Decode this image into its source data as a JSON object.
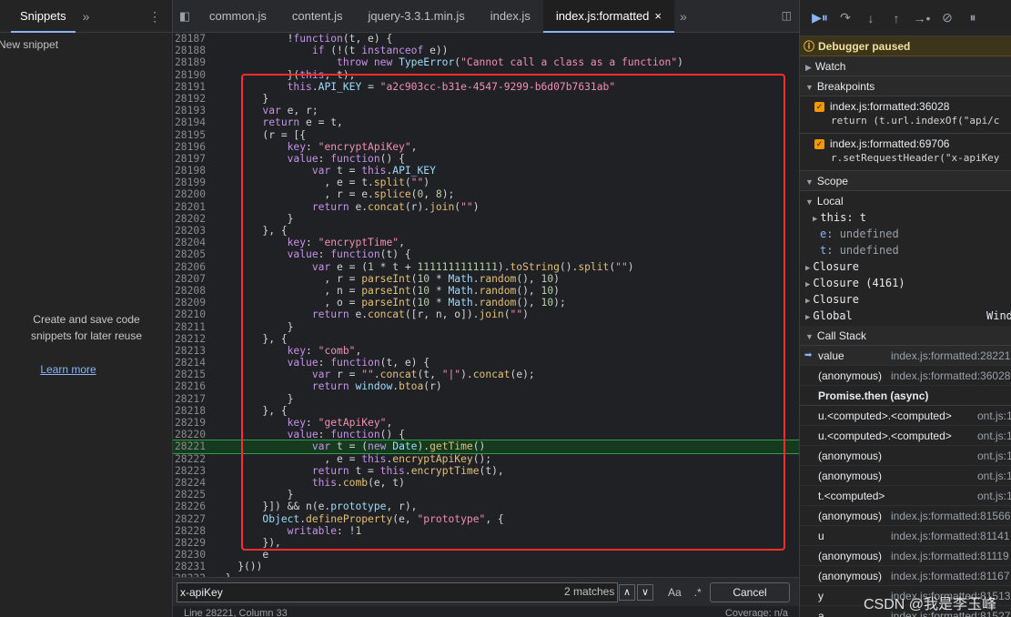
{
  "left_panel": {
    "tab": "Snippets",
    "more": "»",
    "kebab": "⋮",
    "new_snippet": "New snippet",
    "empty_line1": "Create and save code",
    "empty_line2": "snippets for later reuse",
    "learn_more": "Learn more"
  },
  "file_tabs": {
    "nav": "◧",
    "items": [
      "common.js",
      "content.js",
      "jquery-3.3.1.min.js",
      "index.js",
      "index.js:formatted"
    ],
    "close": "×",
    "overflow": "»",
    "right_toggle": "◫"
  },
  "code": {
    "lines": [
      {
        "n": "28187",
        "t": "            !function(t, e) {"
      },
      {
        "n": "28188",
        "t": "                if (!(t instanceof e))"
      },
      {
        "n": "28189",
        "t": "                    throw new TypeError(\"Cannot call a class as a function\")"
      },
      {
        "n": "28190",
        "t": "            }(this, t),"
      },
      {
        "n": "28191",
        "t": "            this.API_KEY = \"a2c903cc-b31e-4547-9299-b6d07b7631ab\""
      },
      {
        "n": "28192",
        "t": "        }"
      },
      {
        "n": "28193",
        "t": "        var e, r;"
      },
      {
        "n": "28194",
        "t": "        return e = t,"
      },
      {
        "n": "28195",
        "t": "        (r = [{"
      },
      {
        "n": "28196",
        "t": "            key: \"encryptApiKey\","
      },
      {
        "n": "28197",
        "t": "            value: function() {"
      },
      {
        "n": "28198",
        "t": "                var t = this.API_KEY"
      },
      {
        "n": "28199",
        "t": "                  , e = t.split(\"\")"
      },
      {
        "n": "28200",
        "t": "                  , r = e.splice(0, 8);"
      },
      {
        "n": "28201",
        "t": "                return e.concat(r).join(\"\")"
      },
      {
        "n": "28202",
        "t": "            }"
      },
      {
        "n": "28203",
        "t": "        }, {"
      },
      {
        "n": "28204",
        "t": "            key: \"encryptTime\","
      },
      {
        "n": "28205",
        "t": "            value: function(t) {"
      },
      {
        "n": "28206",
        "t": "                var e = (1 * t + 1111111111111).toString().split(\"\")"
      },
      {
        "n": "28207",
        "t": "                  , r = parseInt(10 * Math.random(), 10)"
      },
      {
        "n": "28208",
        "t": "                  , n = parseInt(10 * Math.random(), 10)"
      },
      {
        "n": "28209",
        "t": "                  , o = parseInt(10 * Math.random(), 10);"
      },
      {
        "n": "28210",
        "t": "                return e.concat([r, n, o]).join(\"\")"
      },
      {
        "n": "28211",
        "t": "            }"
      },
      {
        "n": "28212",
        "t": "        }, {"
      },
      {
        "n": "28213",
        "t": "            key: \"comb\","
      },
      {
        "n": "28214",
        "t": "            value: function(t, e) {"
      },
      {
        "n": "28215",
        "t": "                var r = \"\".concat(t, \"|\").concat(e);"
      },
      {
        "n": "28216",
        "t": "                return window.btoa(r)"
      },
      {
        "n": "28217",
        "t": "            }"
      },
      {
        "n": "28218",
        "t": "        }, {"
      },
      {
        "n": "28219",
        "t": "            key: \"getApiKey\","
      },
      {
        "n": "28220",
        "t": "            value: function() {"
      },
      {
        "n": "28221",
        "t": "                var t = (new Date).getTime()",
        "hl": true
      },
      {
        "n": "28222",
        "t": "                  , e = this.encryptApiKey();"
      },
      {
        "n": "28223",
        "t": "                return t = this.encryptTime(t),"
      },
      {
        "n": "28224",
        "t": "                this.comb(e, t)"
      },
      {
        "n": "28225",
        "t": "            }"
      },
      {
        "n": "28226",
        "t": "        }]) && n(e.prototype, r),"
      },
      {
        "n": "28227",
        "t": "        Object.defineProperty(e, \"prototype\", {"
      },
      {
        "n": "28228",
        "t": "            writable: !1"
      },
      {
        "n": "28229",
        "t": "        }),"
      },
      {
        "n": "28230",
        "t": "        e"
      },
      {
        "n": "28231",
        "t": "    }())"
      },
      {
        "n": "28232",
        "t": "  }"
      }
    ]
  },
  "search": {
    "value": "x-apiKey",
    "matches": "2 matches",
    "up": "∧",
    "down": "∨",
    "match_case": "Aa",
    "regex": ".*",
    "cancel": "Cancel"
  },
  "status": {
    "position": "Line 28221, Column 33",
    "coverage": "Coverage: n/a"
  },
  "debugger": {
    "toolbar": [
      "▶⏸",
      "↷",
      "↓",
      "↑",
      "→•",
      "⊘",
      "⏸"
    ],
    "paused": "Debugger paused",
    "watch": "Watch",
    "breakpoints_title": "Breakpoints",
    "breakpoints": [
      {
        "loc": "index.js:formatted:36028",
        "code": "return (t.url.indexOf(\"api/c"
      },
      {
        "loc": "index.js:formatted:69706",
        "code": "r.setRequestHeader(\"x-apiKey"
      }
    ],
    "scope_title": "Scope",
    "scope": {
      "local": "Local",
      "this_label": "this: t",
      "e_key": "e:",
      "e_val": "undefined",
      "t_key": "t:",
      "t_val": "undefined",
      "closure1": "Closure",
      "closure2": "Closure (4161)",
      "closure3": "Closure",
      "global": "Global",
      "global_val": "Windo"
    },
    "callstack_title": "Call Stack",
    "callstack": [
      {
        "fn": "value",
        "loc": "index.js:formatted:28221",
        "current": true
      },
      {
        "fn": "(anonymous)",
        "loc": "index.js:formatted:36028"
      }
    ],
    "async_label": "Promise.then (async)",
    "callstack_async": [
      {
        "fn": "u.<computed>.<computed>",
        "loc": "ont.js:1",
        "short": true
      },
      {
        "fn": "u.<computed>.<computed>",
        "loc": "ont.js:1",
        "short": true
      },
      {
        "fn": "(anonymous)",
        "loc": "ont.js:1",
        "short": true
      },
      {
        "fn": "(anonymous)",
        "loc": "ont.js:1",
        "short": true
      },
      {
        "fn": "t.<computed>",
        "loc": "ont.js:1",
        "short": true
      },
      {
        "fn": "(anonymous)",
        "loc": "index.js:formatted:81566"
      },
      {
        "fn": "u",
        "loc": "index.js:formatted:81141"
      },
      {
        "fn": "(anonymous)",
        "loc": "index.js:formatted:81119"
      },
      {
        "fn": "(anonymous)",
        "loc": "index.js:formatted:81167"
      },
      {
        "fn": "y",
        "loc": "index.js:formatted:81513"
      },
      {
        "fn": "a",
        "loc": "index.js:formatted:81527"
      }
    ]
  },
  "watermark": "CSDN @我是李玉峰",
  "colors": {
    "highlight_border": "#ff2d2d",
    "accent": "#8ab4f8",
    "breakpoint": "#f29900"
  }
}
